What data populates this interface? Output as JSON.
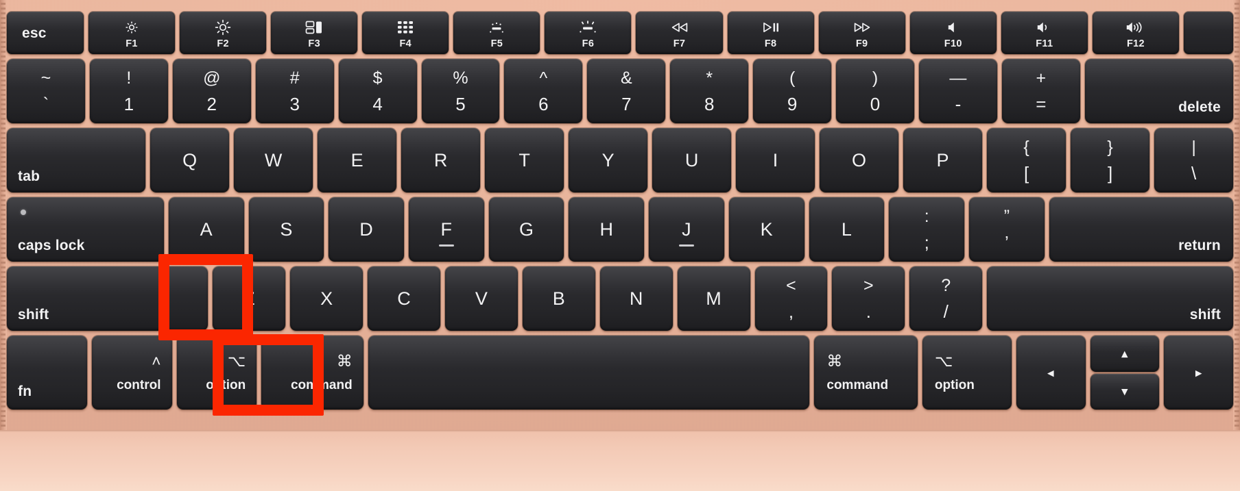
{
  "device": {
    "name": "MacBook keyboard",
    "body_color": "#e8b49c",
    "key_color": "#2a2a2d",
    "legend_color": "#f2f2f3"
  },
  "annotations": {
    "color": "#fb2600",
    "highlighted_keys": [
      "Z",
      "command"
    ],
    "shortcut": "command + Z"
  },
  "rows": {
    "function": [
      {
        "id": "esc",
        "label": "esc",
        "icon": ""
      },
      {
        "id": "f1",
        "label": "F1",
        "icon": "brightness-down-icon"
      },
      {
        "id": "f2",
        "label": "F2",
        "icon": "brightness-up-icon"
      },
      {
        "id": "f3",
        "label": "F3",
        "icon": "mission-control-icon"
      },
      {
        "id": "f4",
        "label": "F4",
        "icon": "launchpad-icon"
      },
      {
        "id": "f5",
        "label": "F5",
        "icon": "keyboard-backlight-down-icon"
      },
      {
        "id": "f6",
        "label": "F6",
        "icon": "keyboard-backlight-up-icon"
      },
      {
        "id": "f7",
        "label": "F7",
        "icon": "rewind-icon"
      },
      {
        "id": "f8",
        "label": "F8",
        "icon": "play-pause-icon"
      },
      {
        "id": "f9",
        "label": "F9",
        "icon": "fast-forward-icon"
      },
      {
        "id": "f10",
        "label": "F10",
        "icon": "mute-icon"
      },
      {
        "id": "f11",
        "label": "F11",
        "icon": "volume-down-icon"
      },
      {
        "id": "f12",
        "label": "F12",
        "icon": "volume-up-icon"
      },
      {
        "id": "touchid",
        "label": "",
        "icon": "touch-id-icon"
      }
    ],
    "number": [
      {
        "id": "backtick",
        "top": "~",
        "bottom": "`"
      },
      {
        "id": "one",
        "top": "!",
        "bottom": "1"
      },
      {
        "id": "two",
        "top": "@",
        "bottom": "2"
      },
      {
        "id": "three",
        "top": "#",
        "bottom": "3"
      },
      {
        "id": "four",
        "top": "$",
        "bottom": "4"
      },
      {
        "id": "five",
        "top": "%",
        "bottom": "5"
      },
      {
        "id": "six",
        "top": "^",
        "bottom": "6"
      },
      {
        "id": "seven",
        "top": "&",
        "bottom": "7"
      },
      {
        "id": "eight",
        "top": "*",
        "bottom": "8"
      },
      {
        "id": "nine",
        "top": "(",
        "bottom": "9"
      },
      {
        "id": "zero",
        "top": ")",
        "bottom": "0"
      },
      {
        "id": "minus",
        "top": "—",
        "bottom": "-"
      },
      {
        "id": "equal",
        "top": "+",
        "bottom": "="
      },
      {
        "id": "delete",
        "label": "delete"
      }
    ],
    "qwerty": [
      {
        "id": "tab",
        "label": "tab"
      },
      {
        "id": "q",
        "label": "Q"
      },
      {
        "id": "w",
        "label": "W"
      },
      {
        "id": "e",
        "label": "E"
      },
      {
        "id": "r",
        "label": "R"
      },
      {
        "id": "t",
        "label": "T"
      },
      {
        "id": "y",
        "label": "Y"
      },
      {
        "id": "u",
        "label": "U"
      },
      {
        "id": "i",
        "label": "I"
      },
      {
        "id": "o",
        "label": "O"
      },
      {
        "id": "p",
        "label": "P"
      },
      {
        "id": "bracket-left",
        "top": "{",
        "bottom": "["
      },
      {
        "id": "bracket-right",
        "top": "}",
        "bottom": "]"
      },
      {
        "id": "backslash",
        "top": "|",
        "bottom": "\\"
      }
    ],
    "home": [
      {
        "id": "caps-lock",
        "label": "caps lock"
      },
      {
        "id": "a",
        "label": "A"
      },
      {
        "id": "s",
        "label": "S"
      },
      {
        "id": "d",
        "label": "D"
      },
      {
        "id": "f",
        "label": "F"
      },
      {
        "id": "g",
        "label": "G"
      },
      {
        "id": "h",
        "label": "H"
      },
      {
        "id": "j",
        "label": "J"
      },
      {
        "id": "k",
        "label": "K"
      },
      {
        "id": "l",
        "label": "L"
      },
      {
        "id": "semicolon",
        "top": ":",
        "bottom": ";"
      },
      {
        "id": "quote",
        "top": "”",
        "bottom": "’"
      },
      {
        "id": "return",
        "label": "return"
      }
    ],
    "shift": [
      {
        "id": "shift-left",
        "label": "shift"
      },
      {
        "id": "z",
        "label": "Z"
      },
      {
        "id": "x",
        "label": "X"
      },
      {
        "id": "c",
        "label": "C"
      },
      {
        "id": "v",
        "label": "V"
      },
      {
        "id": "b",
        "label": "B"
      },
      {
        "id": "n",
        "label": "N"
      },
      {
        "id": "m",
        "label": "M"
      },
      {
        "id": "comma",
        "top": "<",
        "bottom": ","
      },
      {
        "id": "period",
        "top": ">",
        "bottom": "."
      },
      {
        "id": "slash",
        "top": "?",
        "bottom": "/"
      },
      {
        "id": "shift-right",
        "label": "shift"
      }
    ],
    "bottom": [
      {
        "id": "fn",
        "label": "fn",
        "glyph": ""
      },
      {
        "id": "control",
        "label": "control",
        "glyph": "˄"
      },
      {
        "id": "option-left",
        "label": "option",
        "glyph": "⌥"
      },
      {
        "id": "command-left",
        "label": "command",
        "glyph": "⌘"
      },
      {
        "id": "space",
        "label": "",
        "glyph": ""
      },
      {
        "id": "command-right",
        "label": "command",
        "glyph": "⌘"
      },
      {
        "id": "option-right",
        "label": "option",
        "glyph": "⌥"
      },
      {
        "id": "arrow-left",
        "label": "◂",
        "glyph": ""
      },
      {
        "id": "arrow-up",
        "label": "▴",
        "glyph": ""
      },
      {
        "id": "arrow-down",
        "label": "▾",
        "glyph": ""
      },
      {
        "id": "arrow-right",
        "label": "▸",
        "glyph": ""
      }
    ]
  }
}
